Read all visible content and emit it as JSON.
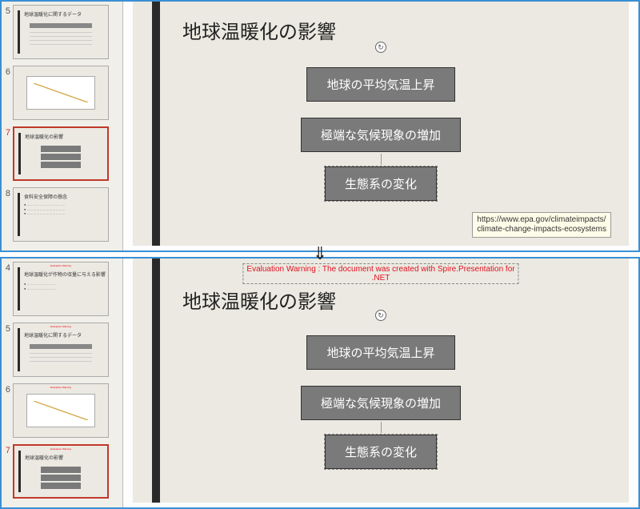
{
  "top": {
    "thumbs": [
      {
        "num": "5",
        "title": "地球温暖化に関するデータ",
        "kind": "table"
      },
      {
        "num": "6",
        "title": "",
        "kind": "chart"
      },
      {
        "num": "7",
        "title": "地球温暖化の影響",
        "kind": "boxes",
        "selected": true
      },
      {
        "num": "8",
        "title": "食料安全保障の懸念",
        "kind": "text"
      }
    ],
    "slide": {
      "title": "地球温暖化の影響",
      "boxes": [
        "地球の平均気温上昇",
        "極端な気候現象の増加",
        "生態系の変化"
      ],
      "tooltip_l1": "https://www.epa.gov/climateimpacts/",
      "tooltip_l2": "climate-change-impacts-ecosystems"
    }
  },
  "arrow": "⇓",
  "bottom": {
    "thumbs": [
      {
        "num": "4",
        "title": "地球温暖化が作物の収量に与える影響",
        "kind": "text",
        "warn": true
      },
      {
        "num": "5",
        "title": "地球温暖化に関するデータ",
        "kind": "table",
        "warn": true
      },
      {
        "num": "6",
        "title": "",
        "kind": "chart",
        "warn": true
      },
      {
        "num": "7",
        "title": "地球温暖化の影響",
        "kind": "boxes",
        "selected": true,
        "warn": true
      }
    ],
    "slide": {
      "title": "地球温暖化の影響",
      "boxes": [
        "地球の平均気温上昇",
        "極端な気候現象の増加",
        "生態系の変化"
      ],
      "warn_l1": "Evaluation Warning : The document was created with Spire.Presentation for",
      "warn_l2": ".NET"
    }
  }
}
